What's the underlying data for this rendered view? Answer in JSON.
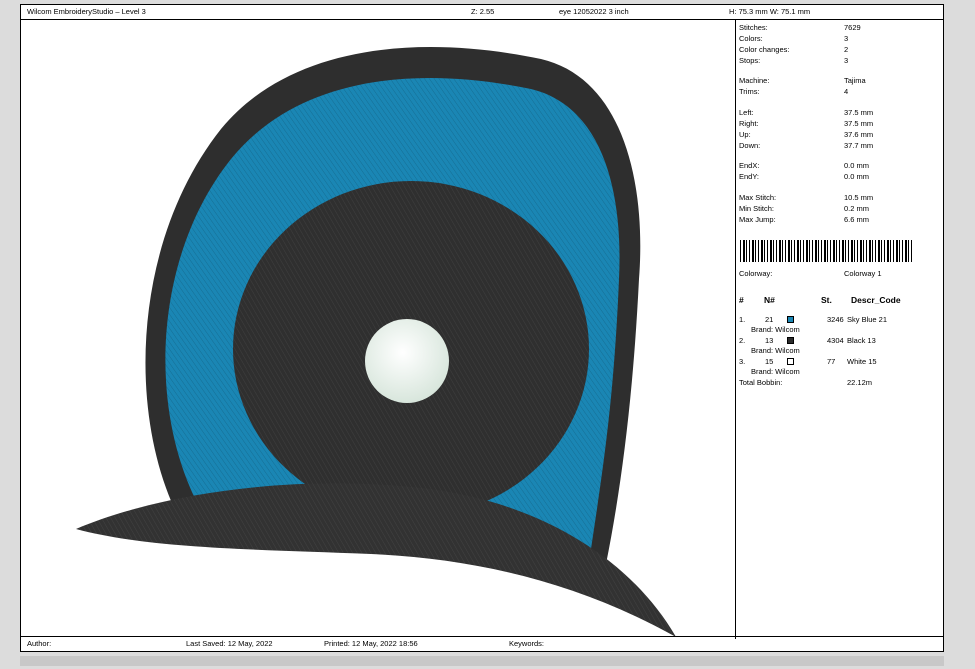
{
  "header": {
    "app_title": "Wilcom EmbroideryStudio – Level 3",
    "zoom": "Z: 2.55",
    "design_name": "eye 12052022 3 inch",
    "size": "H: 75.3 mm   W: 75.1 mm"
  },
  "stats": [
    {
      "label": "Stitches:",
      "value": "7629"
    },
    {
      "label": "Colors:",
      "value": "3"
    },
    {
      "label": "Color changes:",
      "value": "2"
    },
    {
      "label": "Stops:",
      "value": "3"
    },
    {
      "label": "Machine:",
      "value": "Tajima"
    },
    {
      "label": "Trims:",
      "value": "4"
    },
    {
      "label": "Left:",
      "value": "37.5 mm"
    },
    {
      "label": "Right:",
      "value": "37.5 mm"
    },
    {
      "label": "Up:",
      "value": "37.6 mm"
    },
    {
      "label": "Down:",
      "value": "37.7 mm"
    },
    {
      "label": "EndX:",
      "value": "0.0 mm"
    },
    {
      "label": "EndY:",
      "value": "0.0 mm"
    },
    {
      "label": "Max Stitch:",
      "value": "10.5 mm"
    },
    {
      "label": "Min Stitch:",
      "value": "0.2 mm"
    },
    {
      "label": "Max Jump:",
      "value": "6.6 mm"
    }
  ],
  "colorway": {
    "label": "Colorway:",
    "value": "Colorway 1"
  },
  "table_headers": {
    "num": "#",
    "n": "N#",
    "st": "St.",
    "desc": "Descr_Code"
  },
  "colors": [
    {
      "index": "1.",
      "n": "21",
      "color": "#1a86b4",
      "stitches": "3246",
      "desc": "Sky Blue 21",
      "brand": "Brand: Wilcom"
    },
    {
      "index": "2.",
      "n": "13",
      "color": "#2b2b2b",
      "stitches": "4304",
      "desc": "Black 13",
      "brand": "Brand: Wilcom"
    },
    {
      "index": "3.",
      "n": "15",
      "color": "#ffffff",
      "stitches": "77",
      "desc": "White 15",
      "brand": "Brand: Wilcom"
    }
  ],
  "bobbin": {
    "label": "Total Bobbin:",
    "value": "22.12m"
  },
  "footer": {
    "author": "Author:",
    "last_saved": "Last Saved: 12 May, 2022",
    "printed": "Printed: 12 May, 2022 18:56",
    "keywords": "Keywords:"
  }
}
